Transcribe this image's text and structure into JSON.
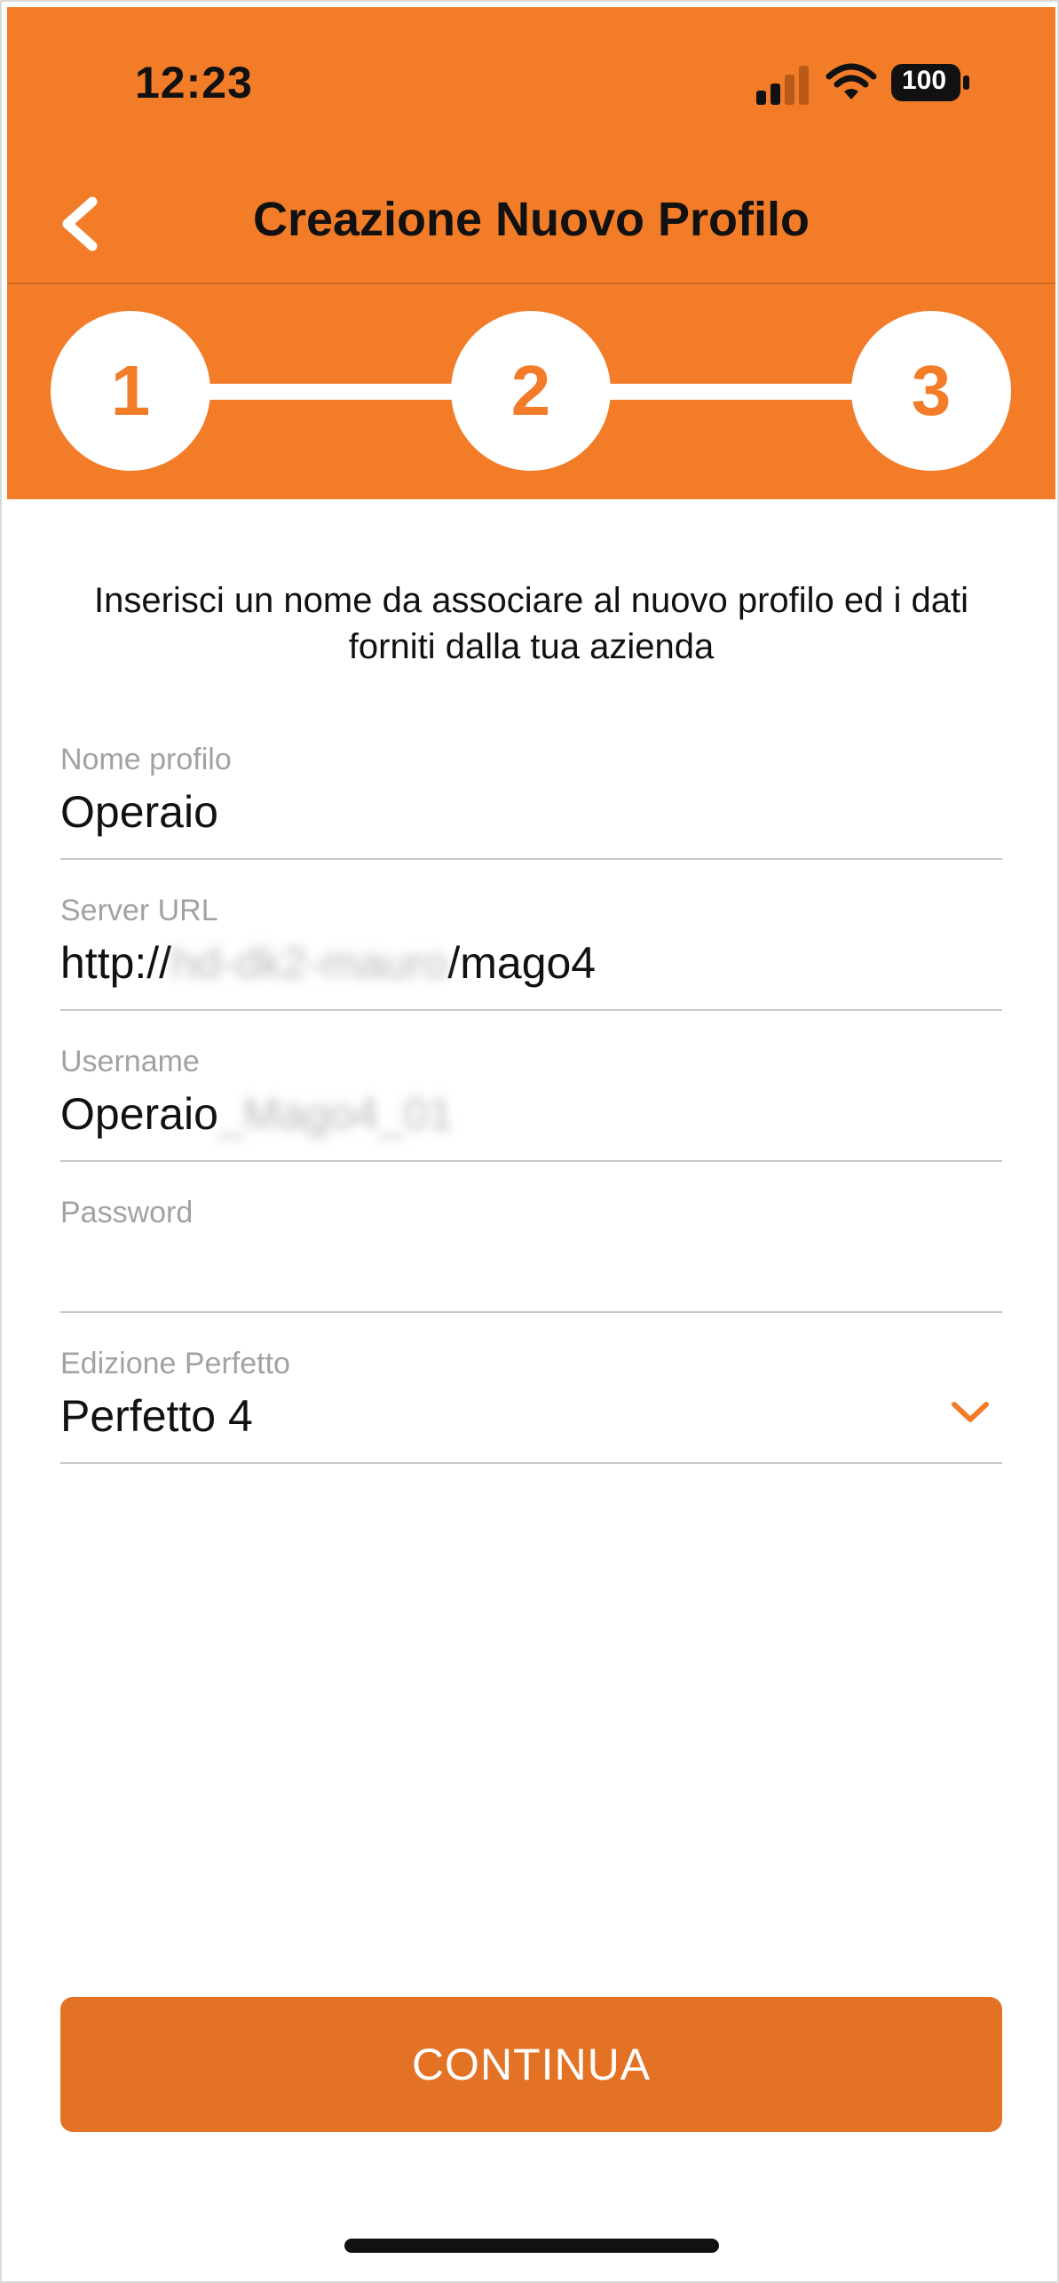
{
  "status_bar": {
    "time": "12:23",
    "battery_level": "100",
    "signal_icon": "cellular-signal-icon",
    "wifi_icon": "wifi-icon"
  },
  "header": {
    "title": "Creazione Nuovo Profilo",
    "back_icon": "chevron-left-icon",
    "background_color": "#f27c28"
  },
  "stepper": {
    "steps": [
      "1",
      "2",
      "3"
    ],
    "current_step": "3"
  },
  "intro_text": "Inserisci un nome da associare al nuovo profilo ed i dati forniti dalla tua azienda",
  "form": {
    "profile_name": {
      "label": "Nome profilo",
      "value": "Operaio"
    },
    "server_url": {
      "label": "Server URL",
      "value_prefix": "http://",
      "value_redacted": "hd-dk2-mauro",
      "value_suffix": "/mago4"
    },
    "username": {
      "label": "Username",
      "value_prefix": "Operaio",
      "value_redacted": "_Mago4_01"
    },
    "password": {
      "label": "Password",
      "value": ""
    },
    "edition": {
      "label": "Edizione Perfetto",
      "value": "Perfetto 4",
      "dropdown_icon": "chevron-down-icon"
    }
  },
  "continue_button": {
    "label": "CONTINUA",
    "color": "#e37224"
  }
}
